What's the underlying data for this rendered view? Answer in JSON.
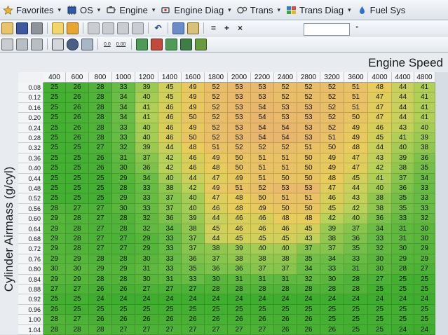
{
  "menubar": [
    {
      "label": "Favorites",
      "icon": "star-icon"
    },
    {
      "label": "OS",
      "icon": "chip-icon"
    },
    {
      "label": "Engine",
      "icon": "engine-icon"
    },
    {
      "label": "Engine Diag",
      "icon": "engine-diag-icon"
    },
    {
      "label": "Trans",
      "icon": "trans-icon"
    },
    {
      "label": "Trans Diag",
      "icon": "trans-diag-icon"
    },
    {
      "label": "Fuel Sys",
      "icon": "fuel-drop-icon"
    }
  ],
  "toolbar": {
    "equals_label": "=",
    "plus_label": "+",
    "times_label": "×",
    "decimals_dec_label": "0.0",
    "decimals_inc_label": "0.00"
  },
  "table": {
    "caption": "Engine Speed",
    "y_axis_label": "Cylinder Airmass (g/cyl)",
    "columns": [
      "400",
      "600",
      "800",
      "1000",
      "1200",
      "1400",
      "1600",
      "1800",
      "2000",
      "2200",
      "2400",
      "2800",
      "3200",
      "3600",
      "4000",
      "4400",
      "4800"
    ],
    "rows": [
      "0.08",
      "0.12",
      "0.16",
      "0.20",
      "0.24",
      "0.28",
      "0.32",
      "0.36",
      "0.40",
      "0.44",
      "0.48",
      "0.52",
      "0.56",
      "0.60",
      "0.64",
      "0.68",
      "0.72",
      "0.76",
      "0.80",
      "0.84",
      "0.88",
      "0.92",
      "0.96",
      "1.00",
      "1.04"
    ],
    "values": [
      [
        "25",
        "26",
        "28",
        "33",
        "39",
        "45",
        "49",
        "52",
        "53",
        "53",
        "52",
        "52",
        "52",
        "51",
        "48",
        "44",
        "41"
      ],
      [
        "25",
        "26",
        "28",
        "34",
        "40",
        "45",
        "49",
        "52",
        "53",
        "53",
        "52",
        "52",
        "52",
        "51",
        "47",
        "44",
        "41"
      ],
      [
        "25",
        "26",
        "28",
        "34",
        "41",
        "46",
        "49",
        "52",
        "53",
        "54",
        "53",
        "53",
        "52",
        "51",
        "47",
        "44",
        "41"
      ],
      [
        "25",
        "26",
        "28",
        "34",
        "41",
        "46",
        "50",
        "52",
        "53",
        "54",
        "53",
        "53",
        "52",
        "50",
        "47",
        "44",
        "41"
      ],
      [
        "25",
        "26",
        "28",
        "33",
        "40",
        "46",
        "49",
        "52",
        "53",
        "54",
        "54",
        "53",
        "52",
        "49",
        "46",
        "43",
        "40"
      ],
      [
        "25",
        "26",
        "28",
        "33",
        "40",
        "46",
        "50",
        "52",
        "53",
        "54",
        "54",
        "53",
        "51",
        "49",
        "45",
        "41",
        "39"
      ],
      [
        "25",
        "25",
        "27",
        "32",
        "39",
        "44",
        "48",
        "51",
        "52",
        "52",
        "52",
        "51",
        "50",
        "48",
        "44",
        "40",
        "38"
      ],
      [
        "25",
        "25",
        "26",
        "31",
        "37",
        "42",
        "46",
        "49",
        "50",
        "51",
        "51",
        "50",
        "49",
        "47",
        "43",
        "39",
        "36"
      ],
      [
        "25",
        "25",
        "26",
        "30",
        "36",
        "42",
        "46",
        "48",
        "50",
        "51",
        "51",
        "50",
        "49",
        "47",
        "42",
        "38",
        "35"
      ],
      [
        "25",
        "25",
        "25",
        "29",
        "34",
        "40",
        "44",
        "47",
        "49",
        "51",
        "50",
        "50",
        "48",
        "45",
        "41",
        "37",
        "34"
      ],
      [
        "25",
        "25",
        "25",
        "28",
        "33",
        "38",
        "42",
        "49",
        "51",
        "52",
        "53",
        "53",
        "47",
        "44",
        "40",
        "36",
        "33"
      ],
      [
        "25",
        "25",
        "25",
        "29",
        "33",
        "37",
        "40",
        "47",
        "48",
        "50",
        "51",
        "51",
        "46",
        "43",
        "38",
        "35",
        "33"
      ],
      [
        "28",
        "27",
        "27",
        "30",
        "33",
        "37",
        "40",
        "46",
        "48",
        "49",
        "50",
        "50",
        "45",
        "42",
        "38",
        "35",
        "33"
      ],
      [
        "29",
        "28",
        "27",
        "28",
        "32",
        "36",
        "39",
        "44",
        "46",
        "46",
        "48",
        "48",
        "42",
        "40",
        "36",
        "33",
        "32"
      ],
      [
        "29",
        "28",
        "27",
        "28",
        "32",
        "34",
        "38",
        "45",
        "46",
        "46",
        "46",
        "45",
        "39",
        "37",
        "34",
        "31",
        "30"
      ],
      [
        "29",
        "28",
        "27",
        "27",
        "29",
        "33",
        "37",
        "44",
        "45",
        "45",
        "45",
        "43",
        "38",
        "36",
        "33",
        "31",
        "30"
      ],
      [
        "29",
        "28",
        "27",
        "27",
        "29",
        "33",
        "37",
        "38",
        "39",
        "40",
        "40",
        "37",
        "37",
        "35",
        "32",
        "30",
        "29"
      ],
      [
        "29",
        "29",
        "28",
        "28",
        "30",
        "33",
        "36",
        "37",
        "38",
        "38",
        "38",
        "35",
        "34",
        "33",
        "30",
        "29",
        "29"
      ],
      [
        "30",
        "30",
        "29",
        "29",
        "31",
        "33",
        "35",
        "36",
        "36",
        "37",
        "37",
        "34",
        "33",
        "31",
        "30",
        "28",
        "27"
      ],
      [
        "29",
        "29",
        "28",
        "28",
        "30",
        "31",
        "33",
        "30",
        "31",
        "31",
        "31",
        "32",
        "30",
        "28",
        "27",
        "25",
        "25"
      ],
      [
        "27",
        "27",
        "26",
        "26",
        "27",
        "27",
        "27",
        "28",
        "28",
        "28",
        "28",
        "28",
        "28",
        "28",
        "25",
        "25",
        "25"
      ],
      [
        "25",
        "25",
        "24",
        "24",
        "24",
        "24",
        "24",
        "24",
        "24",
        "24",
        "24",
        "24",
        "24",
        "24",
        "24",
        "24",
        "24"
      ],
      [
        "26",
        "25",
        "25",
        "25",
        "25",
        "25",
        "25",
        "25",
        "25",
        "25",
        "25",
        "25",
        "25",
        "25",
        "25",
        "25",
        "25"
      ],
      [
        "28",
        "27",
        "26",
        "26",
        "26",
        "26",
        "26",
        "26",
        "26",
        "26",
        "26",
        "26",
        "25",
        "25",
        "25",
        "25",
        "25"
      ],
      [
        "28",
        "28",
        "28",
        "27",
        "27",
        "27",
        "27",
        "27",
        "27",
        "27",
        "26",
        "26",
        "26",
        "25",
        "25",
        "24",
        "24"
      ]
    ]
  },
  "colors": {
    "low": "#3fae2f",
    "mid": "#e6c84b",
    "high": "#e7b46a",
    "header_bg": "#f4f5f7",
    "menubar_bg": "#e8edf3"
  }
}
